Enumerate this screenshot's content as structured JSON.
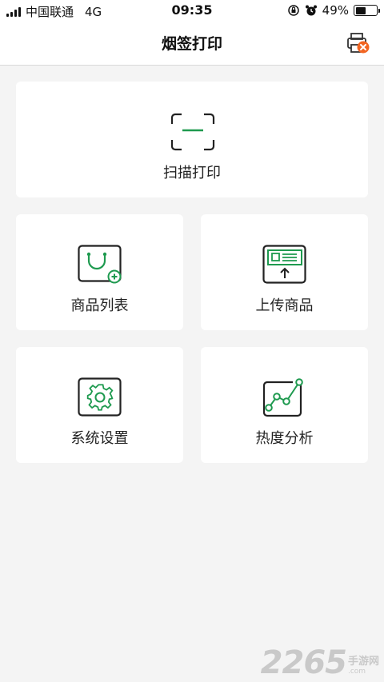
{
  "status_bar": {
    "carrier": "中国联通",
    "network": "4G",
    "time": "09:35",
    "battery_text": "49%",
    "battery_level": 0.49
  },
  "nav": {
    "title": "烟签打印",
    "printer_icon": "printer-error-icon"
  },
  "menu": {
    "scan": {
      "label": "扫描打印",
      "icon": "scan-icon"
    },
    "products": {
      "label": "商品列表",
      "icon": "product-list-icon"
    },
    "upload": {
      "label": "上传商品",
      "icon": "upload-product-icon"
    },
    "settings": {
      "label": "系统设置",
      "icon": "gear-icon"
    },
    "analysis": {
      "label": "热度分析",
      "icon": "trend-chart-icon"
    }
  },
  "watermark": {
    "number": "2265",
    "cn": "手游网",
    "en": ".com"
  },
  "colors": {
    "accent": "#1e9a4f",
    "error": "#f26522",
    "background": "#f4f4f4"
  }
}
